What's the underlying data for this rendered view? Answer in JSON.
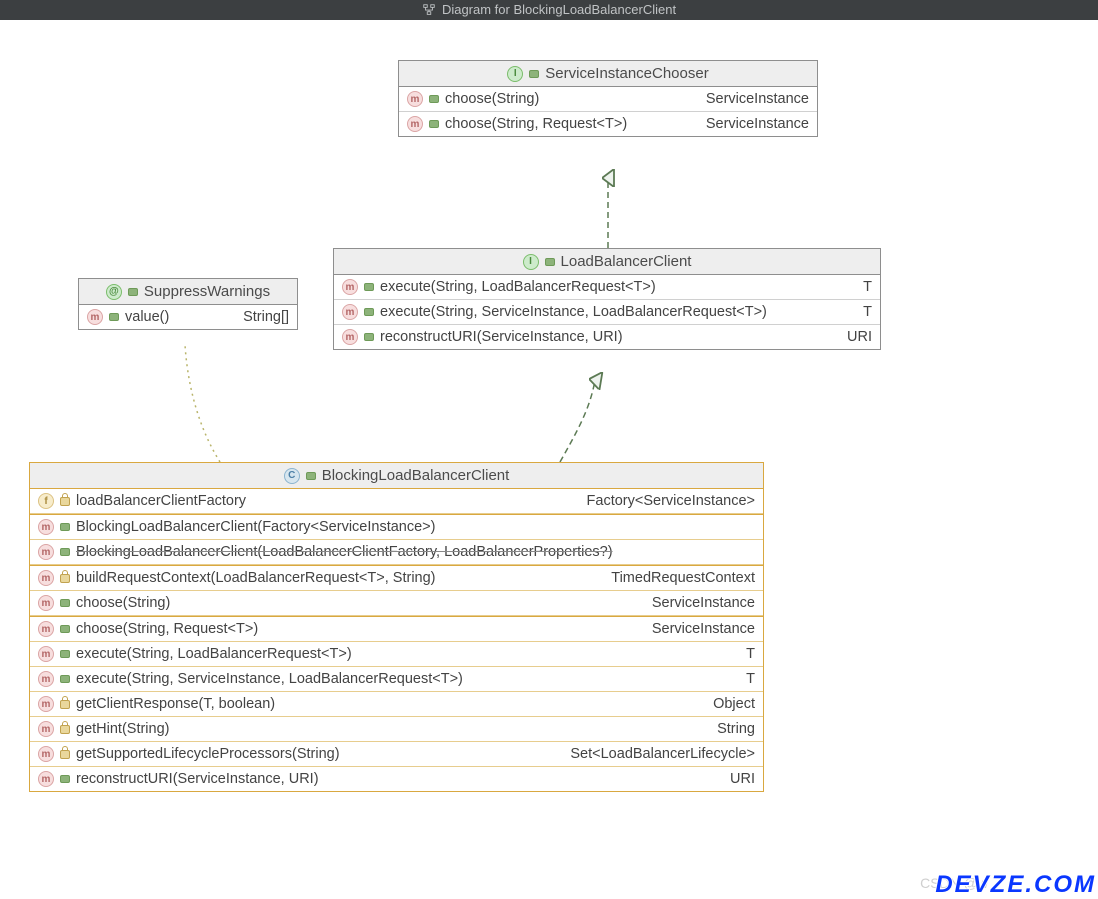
{
  "title": "Diagram for BlockingLoadBalancerClient",
  "watermark_csdn": "CSDN @w",
  "watermark_site": "DEVZE.COM",
  "boxes": {
    "sic": {
      "kind": "interface",
      "name": "ServiceInstanceChooser",
      "members": [
        {
          "icon": "m",
          "vis": "pub",
          "sig": "choose(String)",
          "ret": "ServiceInstance"
        },
        {
          "icon": "m",
          "vis": "pub",
          "sig": "choose(String, Request<T>)",
          "ret": "ServiceInstance"
        }
      ]
    },
    "lbc": {
      "kind": "interface",
      "name": "LoadBalancerClient",
      "members": [
        {
          "icon": "m",
          "vis": "pub",
          "sig": "execute(String, LoadBalancerRequest<T>)",
          "ret": "T"
        },
        {
          "icon": "m",
          "vis": "pub",
          "sig": "execute(String, ServiceInstance, LoadBalancerRequest<T>)",
          "ret": "T"
        },
        {
          "icon": "m",
          "vis": "pub",
          "sig": "reconstructURI(ServiceInstance, URI)",
          "ret": "URI"
        }
      ]
    },
    "sw": {
      "kind": "annotation",
      "name": "SuppressWarnings",
      "members": [
        {
          "icon": "m",
          "vis": "pub",
          "sig": "value()",
          "ret": "String[]"
        }
      ]
    },
    "blbc": {
      "kind": "class",
      "name": "BlockingLoadBalancerClient",
      "fields": [
        {
          "icon": "f",
          "vis": "priv",
          "sig": "loadBalancerClientFactory",
          "ret": "Factory<ServiceInstance>"
        }
      ],
      "ctors": [
        {
          "icon": "m",
          "vis": "pub",
          "sig": "BlockingLoadBalancerClient(Factory<ServiceInstance>)",
          "ret": ""
        },
        {
          "icon": "m",
          "vis": "pub",
          "sig": "BlockingLoadBalancerClient(LoadBalancerClientFactory, LoadBalancerProperties?)",
          "ret": "",
          "strike": true
        }
      ],
      "methods1": [
        {
          "icon": "m",
          "vis": "priv",
          "sig": "buildRequestContext(LoadBalancerRequest<T>, String)",
          "ret": "TimedRequestContext"
        },
        {
          "icon": "m",
          "vis": "pub",
          "sig": "choose(String)",
          "ret": "ServiceInstance"
        }
      ],
      "methods2": [
        {
          "icon": "m",
          "vis": "pub",
          "sig": "choose(String, Request<T>)",
          "ret": "ServiceInstance"
        },
        {
          "icon": "m",
          "vis": "pub",
          "sig": "execute(String, LoadBalancerRequest<T>)",
          "ret": "T"
        },
        {
          "icon": "m",
          "vis": "pub",
          "sig": "execute(String, ServiceInstance, LoadBalancerRequest<T>)",
          "ret": "T"
        },
        {
          "icon": "m",
          "vis": "priv",
          "sig": "getClientResponse(T, boolean)",
          "ret": "Object"
        },
        {
          "icon": "m",
          "vis": "priv",
          "sig": "getHint(String)",
          "ret": "String"
        },
        {
          "icon": "m",
          "vis": "priv",
          "sig": "getSupportedLifecycleProcessors(String)",
          "ret": "Set<LoadBalancerLifecycle>"
        },
        {
          "icon": "m",
          "vis": "pub",
          "sig": "reconstructURI(ServiceInstance, URI)",
          "ret": "URI"
        }
      ]
    }
  }
}
